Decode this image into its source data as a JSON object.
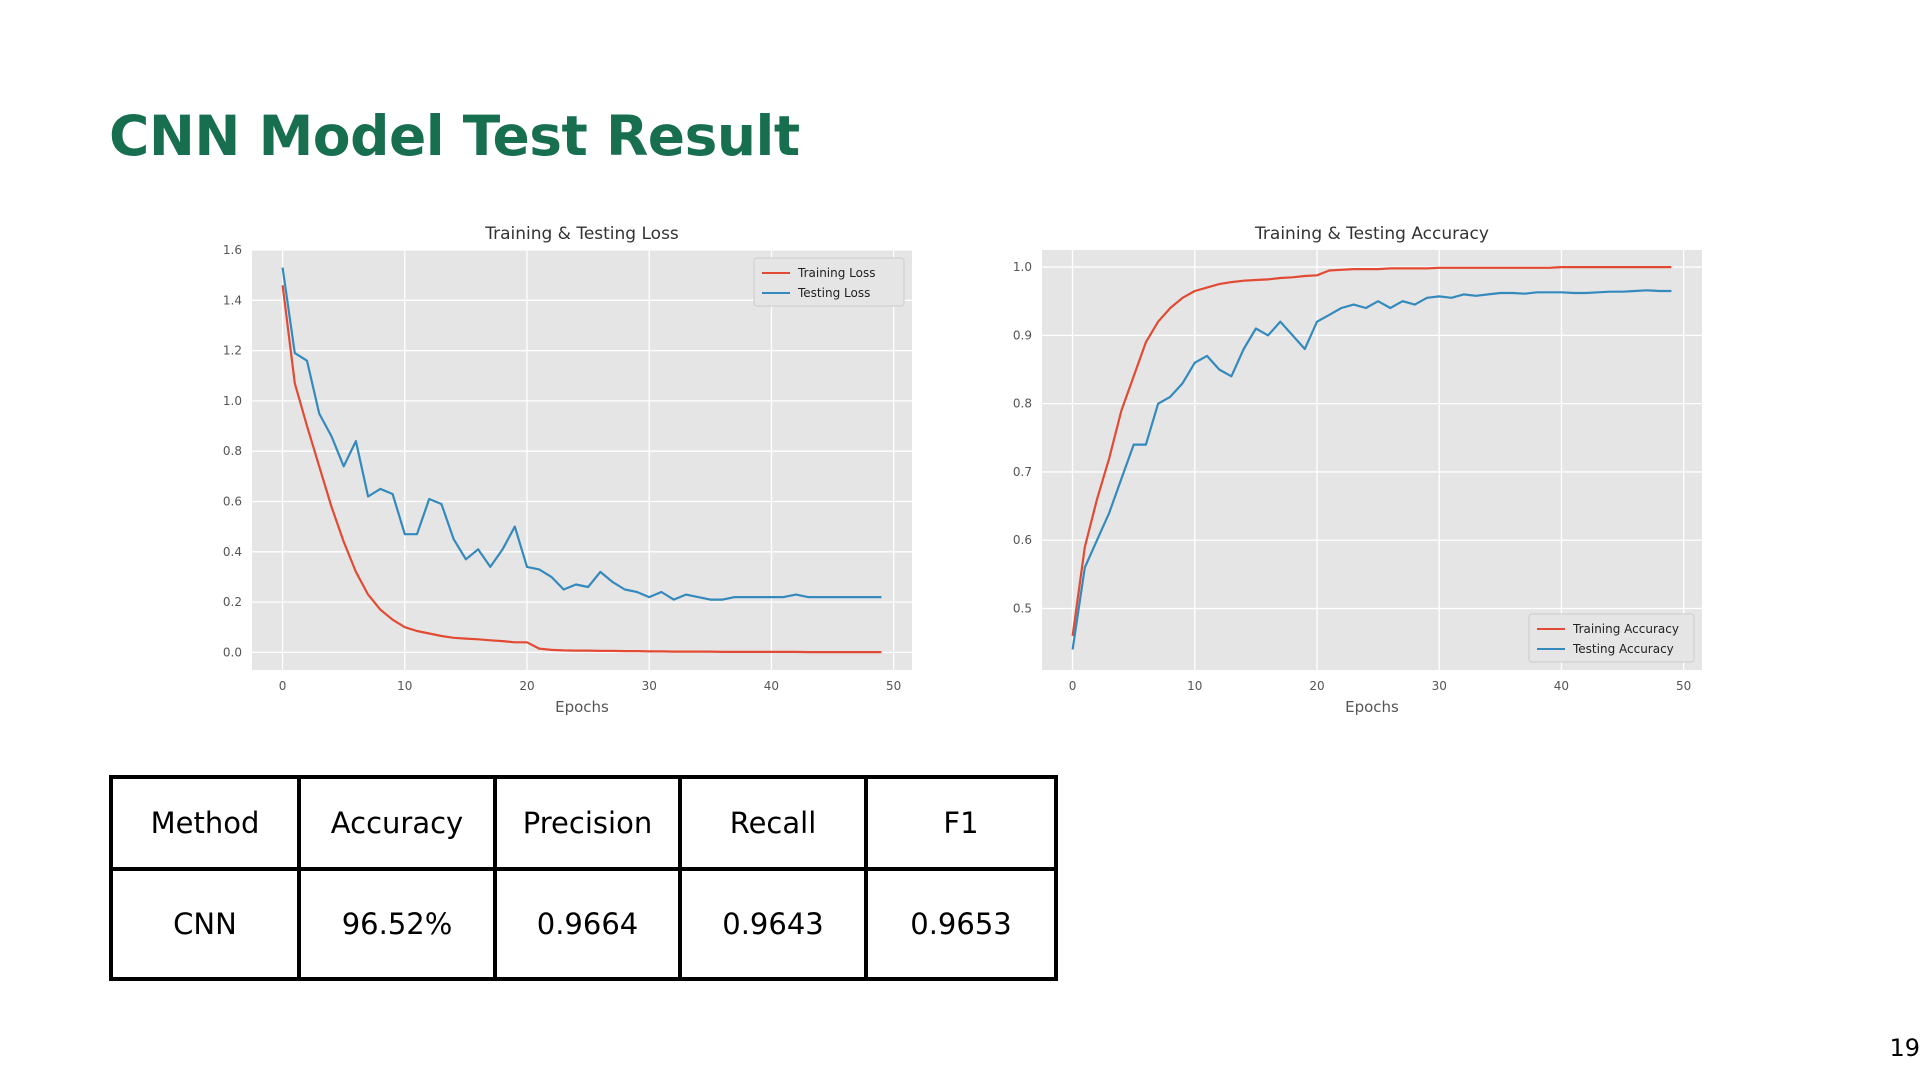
{
  "slide": {
    "title": "CNN Model Test Result",
    "page_number": "19",
    "title_color": "#176f4f"
  },
  "chart_data": [
    {
      "type": "line",
      "title": "Training & Testing Loss",
      "xlabel": "Epochs",
      "ylabel": "",
      "xlim": [
        -2.5,
        51.5
      ],
      "ylim": [
        -0.07,
        1.6
      ],
      "xticks": [
        0,
        10,
        20,
        30,
        40,
        50
      ],
      "yticks": [
        0.0,
        0.2,
        0.4,
        0.6,
        0.8,
        1.0,
        1.2,
        1.4,
        1.6
      ],
      "grid": true,
      "legend_position": "top-right",
      "x": [
        0,
        1,
        2,
        3,
        4,
        5,
        6,
        7,
        8,
        9,
        10,
        11,
        12,
        13,
        14,
        15,
        16,
        17,
        18,
        19,
        20,
        21,
        22,
        23,
        24,
        25,
        26,
        27,
        28,
        29,
        30,
        31,
        32,
        33,
        34,
        35,
        36,
        37,
        38,
        39,
        40,
        41,
        42,
        43,
        44,
        45,
        46,
        47,
        48,
        49
      ],
      "series": [
        {
          "name": "Training Loss",
          "color": "#e24a33",
          "values": [
            1.46,
            1.07,
            0.9,
            0.74,
            0.58,
            0.44,
            0.32,
            0.23,
            0.17,
            0.13,
            0.1,
            0.085,
            0.075,
            0.065,
            0.058,
            0.055,
            0.052,
            0.048,
            0.045,
            0.04,
            0.04,
            0.015,
            0.01,
            0.008,
            0.007,
            0.007,
            0.006,
            0.006,
            0.005,
            0.005,
            0.004,
            0.004,
            0.003,
            0.003,
            0.003,
            0.003,
            0.002,
            0.002,
            0.002,
            0.002,
            0.002,
            0.002,
            0.002,
            0.001,
            0.001,
            0.001,
            0.001,
            0.001,
            0.001,
            0.001
          ]
        },
        {
          "name": "Testing Loss",
          "color": "#348abd",
          "values": [
            1.53,
            1.19,
            1.16,
            0.95,
            0.86,
            0.74,
            0.84,
            0.62,
            0.65,
            0.63,
            0.47,
            0.47,
            0.61,
            0.59,
            0.45,
            0.37,
            0.41,
            0.34,
            0.41,
            0.5,
            0.34,
            0.33,
            0.3,
            0.25,
            0.27,
            0.26,
            0.32,
            0.28,
            0.25,
            0.24,
            0.22,
            0.24,
            0.21,
            0.23,
            0.22,
            0.21,
            0.21,
            0.22,
            0.22,
            0.22,
            0.22,
            0.22,
            0.23,
            0.22,
            0.22,
            0.22,
            0.22,
            0.22,
            0.22,
            0.22
          ]
        }
      ]
    },
    {
      "type": "line",
      "title": "Training & Testing Accuracy",
      "xlabel": "Epochs",
      "ylabel": "",
      "xlim": [
        -2.5,
        51.5
      ],
      "ylim": [
        0.41,
        1.025
      ],
      "xticks": [
        0,
        10,
        20,
        30,
        40,
        50
      ],
      "yticks": [
        0.5,
        0.6,
        0.7,
        0.8,
        0.9,
        1.0
      ],
      "grid": true,
      "legend_position": "bottom-right",
      "x": [
        0,
        1,
        2,
        3,
        4,
        5,
        6,
        7,
        8,
        9,
        10,
        11,
        12,
        13,
        14,
        15,
        16,
        17,
        18,
        19,
        20,
        21,
        22,
        23,
        24,
        25,
        26,
        27,
        28,
        29,
        30,
        31,
        32,
        33,
        34,
        35,
        36,
        37,
        38,
        39,
        40,
        41,
        42,
        43,
        44,
        45,
        46,
        47,
        48,
        49
      ],
      "series": [
        {
          "name": "Training Accuracy",
          "color": "#e24a33",
          "values": [
            0.46,
            0.59,
            0.66,
            0.72,
            0.79,
            0.84,
            0.89,
            0.92,
            0.94,
            0.955,
            0.965,
            0.97,
            0.975,
            0.978,
            0.98,
            0.981,
            0.982,
            0.984,
            0.985,
            0.987,
            0.988,
            0.995,
            0.996,
            0.997,
            0.997,
            0.997,
            0.998,
            0.998,
            0.998,
            0.998,
            0.999,
            0.999,
            0.999,
            0.999,
            0.999,
            0.999,
            0.999,
            0.999,
            0.999,
            0.999,
            1.0,
            1.0,
            1.0,
            1.0,
            1.0,
            1.0,
            1.0,
            1.0,
            1.0,
            1.0
          ]
        },
        {
          "name": "Testing Accuracy",
          "color": "#348abd",
          "values": [
            0.44,
            0.56,
            0.6,
            0.64,
            0.69,
            0.74,
            0.74,
            0.8,
            0.81,
            0.83,
            0.86,
            0.87,
            0.85,
            0.84,
            0.88,
            0.91,
            0.9,
            0.92,
            0.9,
            0.88,
            0.92,
            0.93,
            0.94,
            0.945,
            0.94,
            0.95,
            0.94,
            0.95,
            0.945,
            0.955,
            0.957,
            0.955,
            0.96,
            0.958,
            0.96,
            0.962,
            0.962,
            0.961,
            0.963,
            0.963,
            0.963,
            0.962,
            0.962,
            0.963,
            0.964,
            0.964,
            0.965,
            0.966,
            0.965,
            0.965
          ]
        }
      ]
    },
    {
      "type": "table",
      "headers": [
        "Method",
        "Accuracy",
        "Precision",
        "Recall",
        "F1"
      ],
      "rows": [
        [
          "CNN",
          "96.52%",
          "0.9664",
          "0.9643",
          "0.9653"
        ]
      ]
    }
  ],
  "table": {
    "headers": [
      "Method",
      "Accuracy",
      "Precision",
      "Recall",
      "F1"
    ],
    "rows": [
      [
        "CNN",
        "96.52%",
        "0.9664",
        "0.9643",
        "0.9653"
      ]
    ]
  },
  "colors": {
    "plot_background": "#e5e5e5",
    "grid": "#ffffff",
    "axis_text": "#555555",
    "title_text": "#333333"
  }
}
